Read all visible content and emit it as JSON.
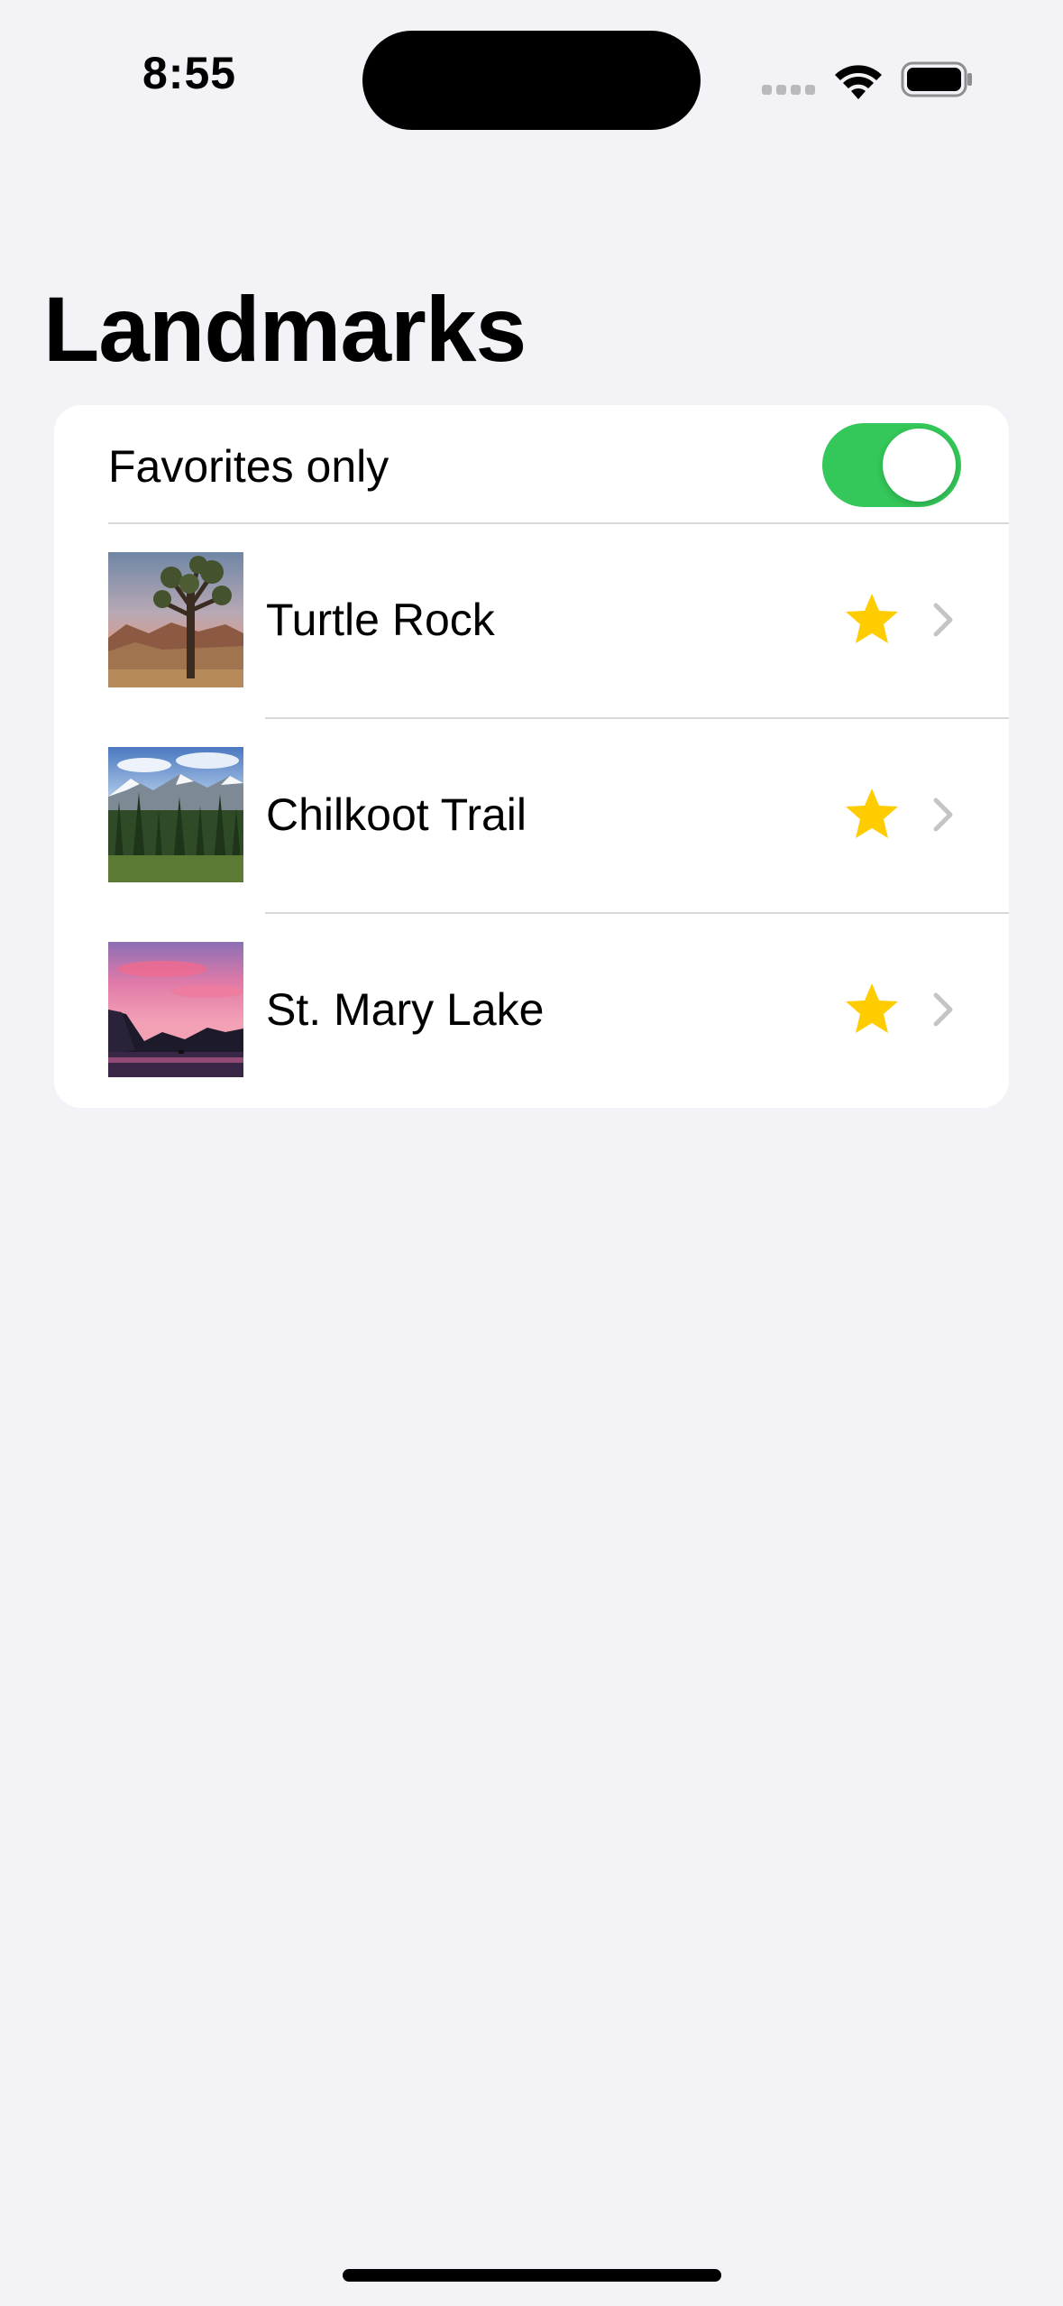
{
  "status_bar": {
    "time": "8:55"
  },
  "header": {
    "title": "Landmarks"
  },
  "filter": {
    "label": "Favorites only",
    "enabled": true
  },
  "landmarks": [
    {
      "name": "Turtle Rock",
      "favorite": true,
      "image_icon": "desert-joshua-tree-photo"
    },
    {
      "name": "Chilkoot Trail",
      "favorite": true,
      "image_icon": "mountain-forest-photo"
    },
    {
      "name": "St. Mary Lake",
      "favorite": true,
      "image_icon": "sunset-lake-photo"
    }
  ],
  "colors": {
    "accent_green": "#34c759",
    "star_yellow": "#ffcc00",
    "background": "#f2f2f7"
  }
}
